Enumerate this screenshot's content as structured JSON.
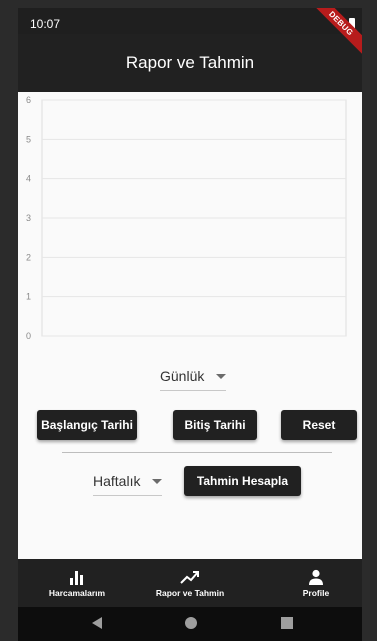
{
  "status_bar": {
    "time": "10:07",
    "battery_icon": "battery-icon"
  },
  "debug_banner": "DEBUG",
  "app_bar": {
    "title": "Rapor ve Tahmin"
  },
  "chart_data": {
    "type": "line",
    "title": "",
    "xlabel": "",
    "ylabel": "",
    "ylim": [
      0,
      6
    ],
    "y_ticks": [
      "0",
      "1",
      "2",
      "3",
      "4",
      "5",
      "6"
    ],
    "grid": true,
    "series": []
  },
  "period_dropdown": {
    "selected": "Günlük"
  },
  "buttons": {
    "start_date": "Başlangıç Tarihi",
    "end_date": "Bitiş Tarihi",
    "reset": "Reset",
    "calculate": "Tahmin Hesapla"
  },
  "forecast_dropdown": {
    "selected": "Haftalık"
  },
  "bottom_nav": [
    {
      "label": "Harcamalarım",
      "icon": "bar-chart-icon"
    },
    {
      "label": "Rapor ve Tahmin",
      "icon": "trending-up-icon"
    },
    {
      "label": "Profile",
      "icon": "person-icon"
    }
  ],
  "system_nav": {
    "back_icon": "back-icon",
    "home_icon": "home-icon",
    "recents_icon": "recents-icon"
  },
  "colors": {
    "app_bar": "#212121",
    "background": "#fafafa",
    "banner": "#b71c1c"
  }
}
